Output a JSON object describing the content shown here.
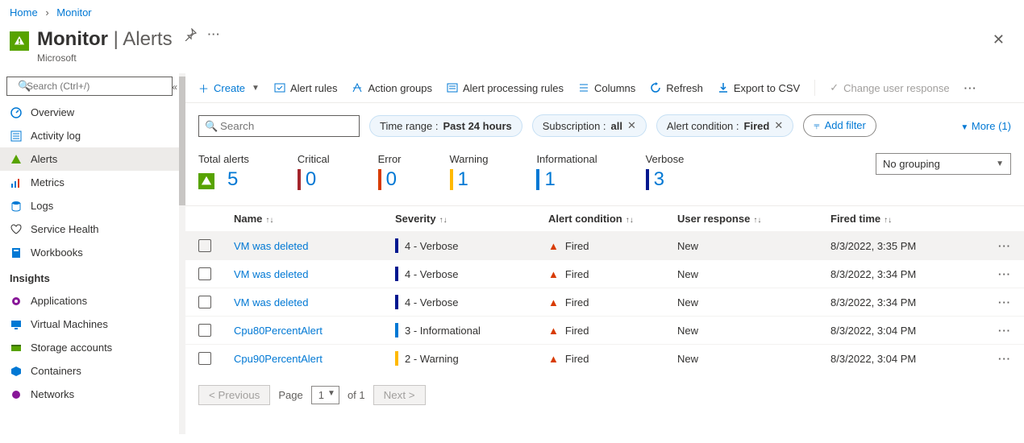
{
  "breadcrumb": {
    "home": "Home",
    "monitor": "Monitor"
  },
  "header": {
    "title": "Monitor",
    "section": "Alerts",
    "provider": "Microsoft"
  },
  "sidebar": {
    "search_placeholder": "Search (Ctrl+/)",
    "items": [
      {
        "label": "Overview"
      },
      {
        "label": "Activity log"
      },
      {
        "label": "Alerts"
      },
      {
        "label": "Metrics"
      },
      {
        "label": "Logs"
      },
      {
        "label": "Service Health"
      },
      {
        "label": "Workbooks"
      }
    ],
    "insights_heading": "Insights",
    "insights": [
      {
        "label": "Applications"
      },
      {
        "label": "Virtual Machines"
      },
      {
        "label": "Storage accounts"
      },
      {
        "label": "Containers"
      },
      {
        "label": "Networks"
      }
    ]
  },
  "toolbar": {
    "create": "Create",
    "alert_rules": "Alert rules",
    "action_groups": "Action groups",
    "processing_rules": "Alert processing rules",
    "columns": "Columns",
    "refresh": "Refresh",
    "export": "Export to CSV",
    "change_response": "Change user response"
  },
  "filters": {
    "search_placeholder": "Search",
    "time": {
      "label": "Time range :",
      "value": "Past 24 hours"
    },
    "sub": {
      "label": "Subscription :",
      "value": "all"
    },
    "cond": {
      "label": "Alert condition :",
      "value": "Fired"
    },
    "add": "Add filter",
    "more": "More (1)"
  },
  "summary": {
    "total": {
      "label": "Total alerts",
      "value": "5"
    },
    "critical": {
      "label": "Critical",
      "value": "0"
    },
    "error": {
      "label": "Error",
      "value": "0"
    },
    "warning": {
      "label": "Warning",
      "value": "1"
    },
    "info": {
      "label": "Informational",
      "value": "1"
    },
    "verbose": {
      "label": "Verbose",
      "value": "3"
    },
    "grouping": "No grouping"
  },
  "table": {
    "headers": {
      "name": "Name",
      "severity": "Severity",
      "condition": "Alert condition",
      "response": "User response",
      "fired": "Fired time"
    },
    "rows": [
      {
        "name": "VM was deleted",
        "severity": "4 - Verbose",
        "sev_color": "#00188f",
        "condition": "Fired",
        "response": "New",
        "fired": "8/3/2022, 3:35 PM"
      },
      {
        "name": "VM was deleted",
        "severity": "4 - Verbose",
        "sev_color": "#00188f",
        "condition": "Fired",
        "response": "New",
        "fired": "8/3/2022, 3:34 PM"
      },
      {
        "name": "VM was deleted",
        "severity": "4 - Verbose",
        "sev_color": "#00188f",
        "condition": "Fired",
        "response": "New",
        "fired": "8/3/2022, 3:34 PM"
      },
      {
        "name": "Cpu80PercentAlert",
        "severity": "3 - Informational",
        "sev_color": "#0078d4",
        "condition": "Fired",
        "response": "New",
        "fired": "8/3/2022, 3:04 PM"
      },
      {
        "name": "Cpu90PercentAlert",
        "severity": "2 - Warning",
        "sev_color": "#ffb900",
        "condition": "Fired",
        "response": "New",
        "fired": "8/3/2022, 3:04 PM"
      }
    ]
  },
  "pager": {
    "prev": "< Previous",
    "page_label": "Page",
    "page": "1",
    "of": "of 1",
    "next": "Next >"
  }
}
